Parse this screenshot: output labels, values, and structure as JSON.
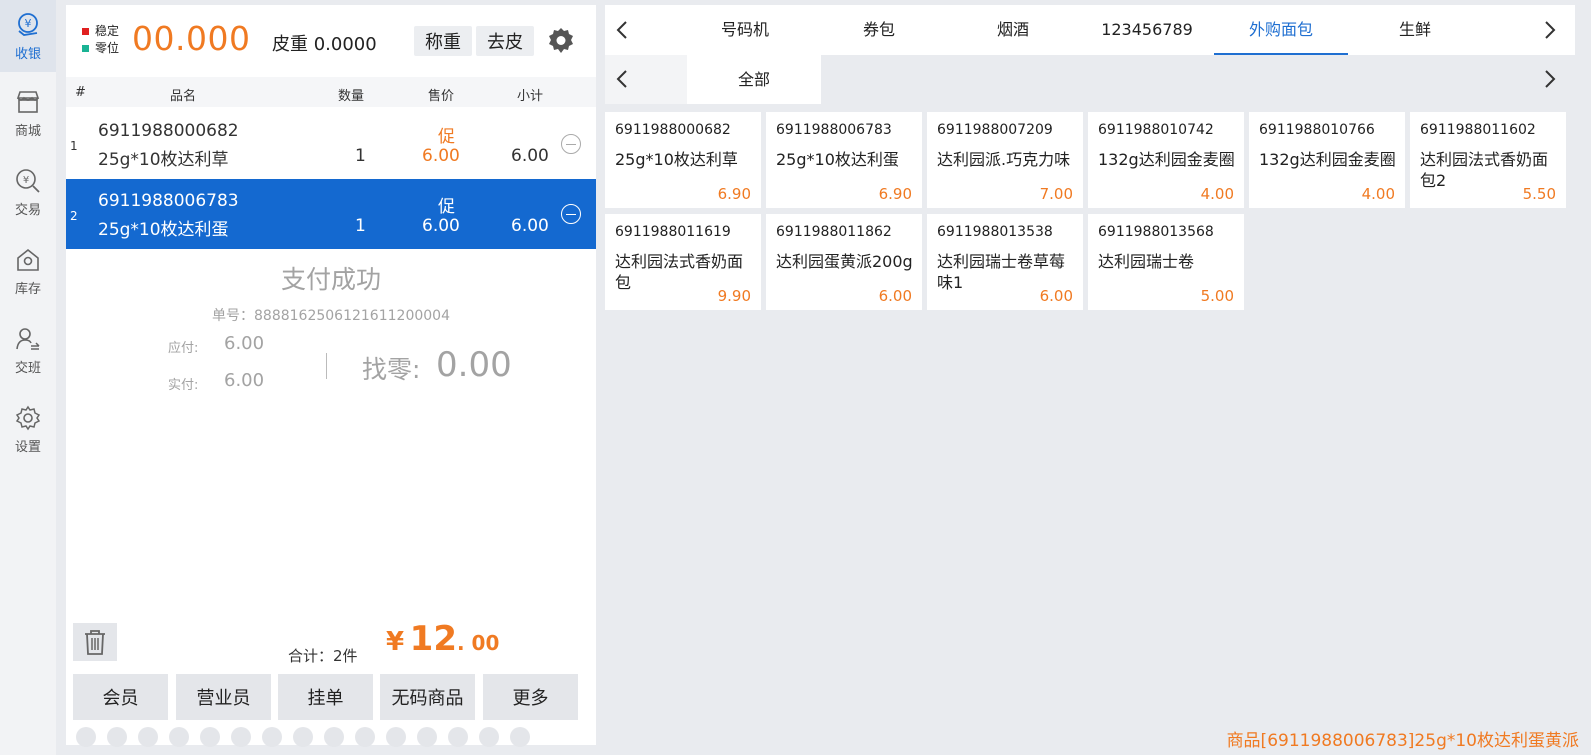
{
  "nav": {
    "items": [
      {
        "label": "收银",
        "icon": "cashier-icon",
        "active": true
      },
      {
        "label": "商城",
        "icon": "store-icon"
      },
      {
        "label": "交易",
        "icon": "transaction-icon"
      },
      {
        "label": "库存",
        "icon": "inventory-icon"
      },
      {
        "label": "交班",
        "icon": "shift-icon"
      },
      {
        "label": "设置",
        "icon": "settings-icon"
      }
    ]
  },
  "scale": {
    "stable_label": "稳定",
    "zero_label": "零位",
    "stable_color": "#e02020",
    "zero_color": "#1ab394",
    "weight": "00.000",
    "tare": "皮重 0.0000",
    "weigh_button": "称重",
    "tare_button": "去皮"
  },
  "table": {
    "headers": {
      "idx": "#",
      "name": "品名",
      "qty": "数量",
      "price": "售价",
      "subtotal": "小计"
    },
    "rows": [
      {
        "idx": "1",
        "code": "6911988000682",
        "name": "25g*10枚达利草",
        "qty": "1",
        "promo": "促",
        "price": "6.00",
        "subtotal": "6.00"
      },
      {
        "idx": "2",
        "code": "6911988006783",
        "name": "25g*10枚达利蛋",
        "qty": "1",
        "promo": "促",
        "price": "6.00",
        "subtotal": "6.00"
      }
    ]
  },
  "payment": {
    "title": "支付成功",
    "order_no": "单号：888816250612161120000​4",
    "due_label": "应付:",
    "due": "6.00",
    "paid_label": "实付:",
    "paid": "6.00",
    "change_label": "找零:",
    "change": "0.00"
  },
  "summary": {
    "count": "合计：2件",
    "currency": "¥",
    "total_int": "12",
    "total_dec": ". 00"
  },
  "actions": {
    "member": "会员",
    "salesperson": "营业员",
    "hold": "挂单",
    "no_code": "无码商品",
    "more": "更多"
  },
  "categories": {
    "tabs": [
      "号码机",
      "券包",
      "烟酒",
      "123456789",
      "外购面包",
      "生鲜"
    ],
    "active": "外购面包",
    "subtab": "全部"
  },
  "products": [
    {
      "code": "6911988000682",
      "name": "25g*10枚达利草",
      "price": "6.90"
    },
    {
      "code": "6911988006783",
      "name": "25g*10枚达利蛋",
      "price": "6.90"
    },
    {
      "code": "6911988007209",
      "name": "达利园派.巧克力味",
      "price": "7.00"
    },
    {
      "code": "6911988010742",
      "name": "132g达利园金麦圈",
      "price": "4.00"
    },
    {
      "code": "6911988010766",
      "name": "132g达利园金麦圈",
      "price": "4.00"
    },
    {
      "code": "6911988011602",
      "name": "达利园法式香奶面包2",
      "price": "5.50"
    },
    {
      "code": "6911988011619",
      "name": "达利园法式香奶面包",
      "price": "9.90"
    },
    {
      "code": "6911988011862",
      "name": "达利园蛋黄派200g",
      "price": "6.00"
    },
    {
      "code": "6911988013538",
      "name": "达利园瑞士卷草莓味1",
      "price": "6.00"
    },
    {
      "code": "6911988013568",
      "name": "达利园瑞士卷",
      "price": "5.00"
    }
  ],
  "status_message": "商品[6911988006783]25g*10枚达利蛋黄派"
}
